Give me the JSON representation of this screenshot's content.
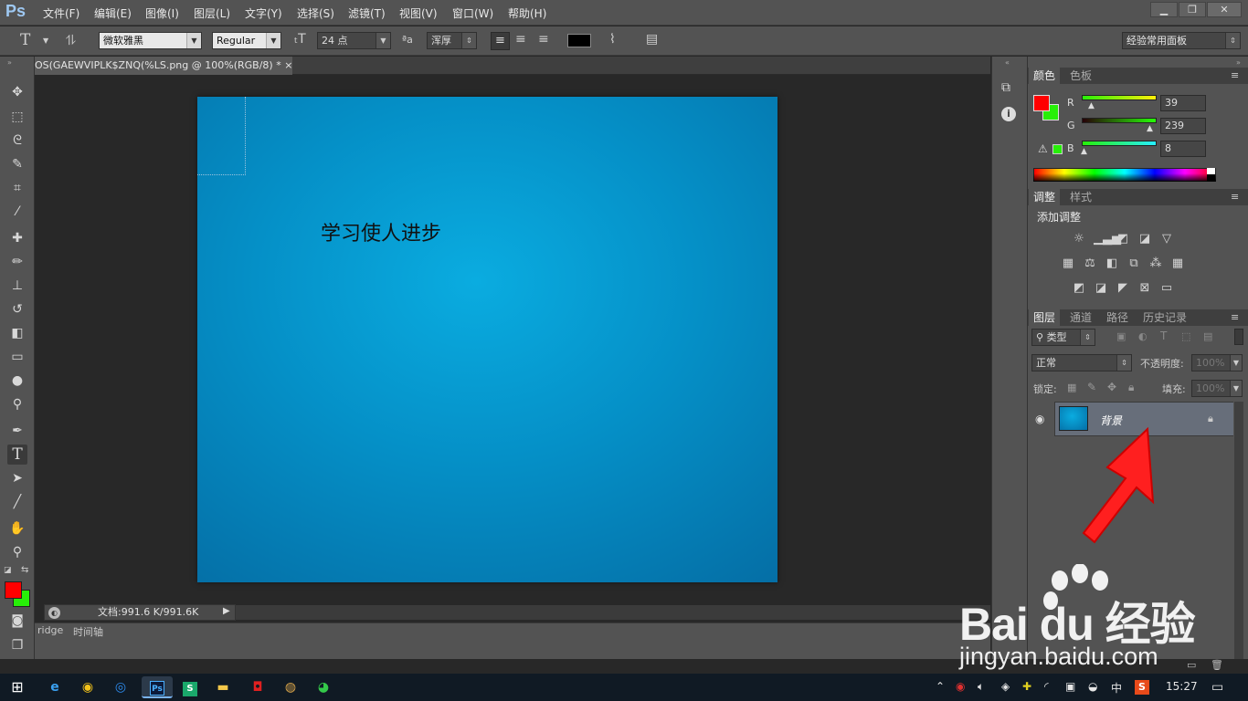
{
  "app": {
    "logo": "Ps"
  },
  "menu": [
    "文件(F)",
    "编辑(E)",
    "图像(I)",
    "图层(L)",
    "文字(Y)",
    "选择(S)",
    "滤镜(T)",
    "视图(V)",
    "窗口(W)",
    "帮助(H)"
  ],
  "window_controls": {
    "minimize": "▁",
    "restore": "❐",
    "close": "✕"
  },
  "options": {
    "font_family": "微软雅黑",
    "font_style": "Regular",
    "font_size": "24 点",
    "antialias_icon": "ªa",
    "antialias": "浑厚",
    "workspace": "经验常用面板"
  },
  "document": {
    "tab_title": "OS(GAEWVIPLK$ZNQ(%LS.png @ 100%(RGB/8) *",
    "tab_close": "×",
    "canvas_text": "学习使人进步",
    "status": "文档:991.6 K/991.6K"
  },
  "bottom_tabs": [
    "ridge",
    "时间轴"
  ],
  "color_panel": {
    "tabs": [
      "颜色",
      "色板"
    ],
    "r_label": "R",
    "g_label": "G",
    "b_label": "B",
    "r": "39",
    "g": "239",
    "b": "8",
    "fg_color": "#ff0000",
    "bg_color": "#27ef08"
  },
  "adjust_panel": {
    "tabs": [
      "调整",
      "样式"
    ],
    "title": "添加调整"
  },
  "layers_panel": {
    "tabs": [
      "图层",
      "通道",
      "路径",
      "历史记录"
    ],
    "filter_label": "类型",
    "blend_mode": "正常",
    "opacity_label": "不透明度:",
    "opacity": "100%",
    "lock_label": "锁定:",
    "fill_label": "填充:",
    "fill": "100%",
    "layer_name": "背景"
  },
  "taskbar": {
    "time": "15:27",
    "ime": "中"
  },
  "watermark": {
    "logo": "Bai du 经验",
    "url": "jingyan.baidu.com"
  }
}
